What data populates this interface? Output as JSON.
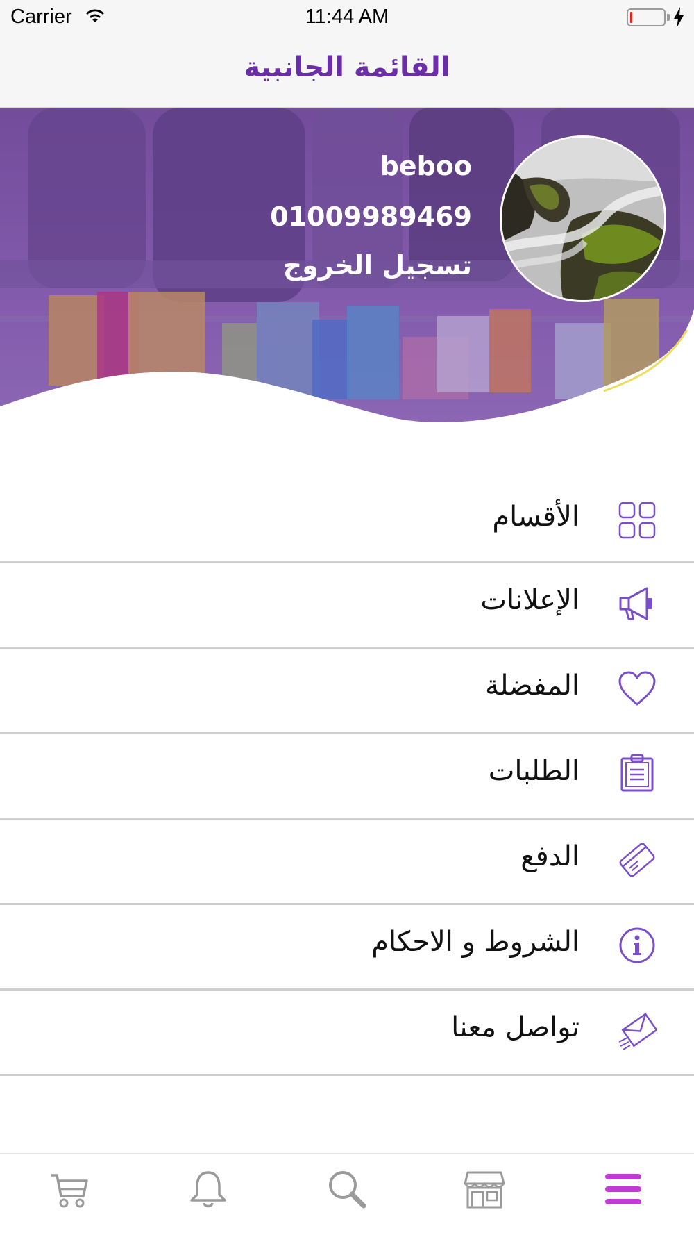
{
  "status_bar": {
    "carrier": "Carrier",
    "time": "11:44 AM"
  },
  "nav": {
    "title": "القائمة الجانبية"
  },
  "profile": {
    "name": "beboo",
    "phone": "01009989469",
    "logout_label": "تسجيل الخروج"
  },
  "menu": {
    "items": [
      {
        "label": "الأقسام",
        "icon": "grid-icon"
      },
      {
        "label": "الإعلانات",
        "icon": "megaphone-icon"
      },
      {
        "label": "المفضلة",
        "icon": "heart-icon"
      },
      {
        "label": "الطلبات",
        "icon": "clipboard-icon"
      },
      {
        "label": "الدفع",
        "icon": "credit-card-icon"
      },
      {
        "label": "الشروط و الاحكام",
        "icon": "info-icon"
      },
      {
        "label": "تواصل معنا",
        "icon": "send-mail-icon"
      }
    ]
  },
  "tab_bar": {
    "tabs": [
      {
        "icon": "cart-icon"
      },
      {
        "icon": "bell-icon"
      },
      {
        "icon": "search-icon"
      },
      {
        "icon": "store-icon"
      },
      {
        "icon": "menu-icon",
        "active": true
      }
    ]
  },
  "colors": {
    "accent": "#6a2fa8",
    "active_tab": "#c23ad6",
    "inactive_tab": "#9a9a9a",
    "hero_overlay": "#7a4fb0"
  }
}
